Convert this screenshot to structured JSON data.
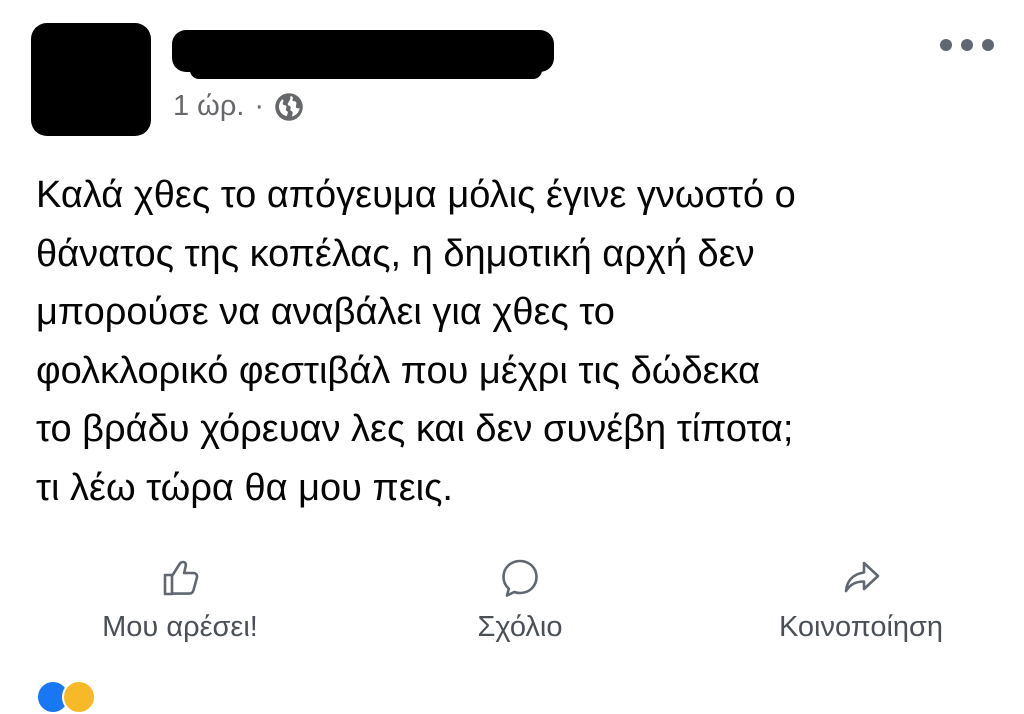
{
  "post": {
    "timestamp": "1 ώρ.",
    "separator": "·",
    "privacy_icon": "globe-icon",
    "text": "Καλά χθες το απόγευμα μόλις έγινε γνωστό ο\nθάνατος της κοπέλας, η δημοτική αρχή δεν\nμπορούσε να αναβάλει για χθες το\nφολκλορικό φεστιβάλ που μέχρι τις δώδεκα\nτο βράδυ χόρευαν λες και δεν συνέβη τίποτα;\nτι λέω τώρα θα μου πεις."
  },
  "actions": {
    "like_label": "Μου αρέσει!",
    "comment_label": "Σχόλιο",
    "share_label": "Κοινοποίηση"
  },
  "icons": {
    "more": "more-options-icon",
    "like": "thumbs-up-icon",
    "comment": "comment-bubble-icon",
    "share": "share-arrow-icon"
  },
  "colors": {
    "text": "#050505",
    "secondary_text": "#65676b",
    "action_text": "#4b4f56",
    "icon": "#606770",
    "redaction": "#000000"
  }
}
